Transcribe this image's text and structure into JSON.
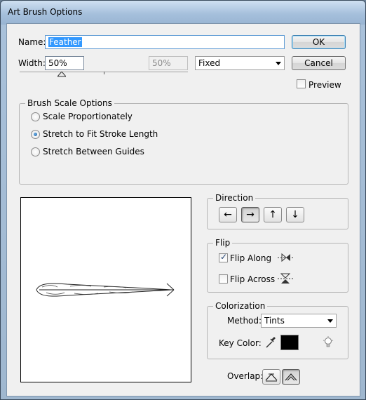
{
  "window": {
    "title": "Art Brush Options"
  },
  "name_field": {
    "label": "Name:",
    "value": "Feather"
  },
  "width_field": {
    "label": "Width:",
    "value": "50%",
    "variation_value": "50%",
    "slider_level_percent": 50
  },
  "width_mode": {
    "selected": "Fixed"
  },
  "buttons": {
    "ok": "OK",
    "cancel": "Cancel"
  },
  "preview_checkbox": {
    "label": "Preview",
    "checked": false
  },
  "brush_scale": {
    "title": "Brush Scale Options",
    "options": [
      {
        "label": "Scale Proportionately",
        "selected": false
      },
      {
        "label": "Stretch to Fit Stroke Length",
        "selected": true
      },
      {
        "label": "Stretch Between Guides",
        "selected": false
      }
    ]
  },
  "direction": {
    "title": "Direction",
    "buttons": [
      {
        "icon": "arrow-left-icon",
        "glyph": "←",
        "pressed": false
      },
      {
        "icon": "arrow-right-icon",
        "glyph": "→",
        "pressed": true
      },
      {
        "icon": "arrow-up-icon",
        "glyph": "↑",
        "pressed": false
      },
      {
        "icon": "arrow-down-icon",
        "glyph": "↓",
        "pressed": false
      }
    ]
  },
  "flip": {
    "title": "Flip",
    "along": {
      "label": "Flip Along",
      "checked": true
    },
    "across": {
      "label": "Flip Across",
      "checked": false
    }
  },
  "colorization": {
    "title": "Colorization",
    "method_label": "Method:",
    "method_value": "Tints",
    "key_color_label": "Key Color:",
    "key_color": "#000000"
  },
  "overlap": {
    "label": "Overlap:"
  },
  "colors": {
    "accent": "#3399ff",
    "title_bar": "#a6c0dc"
  }
}
